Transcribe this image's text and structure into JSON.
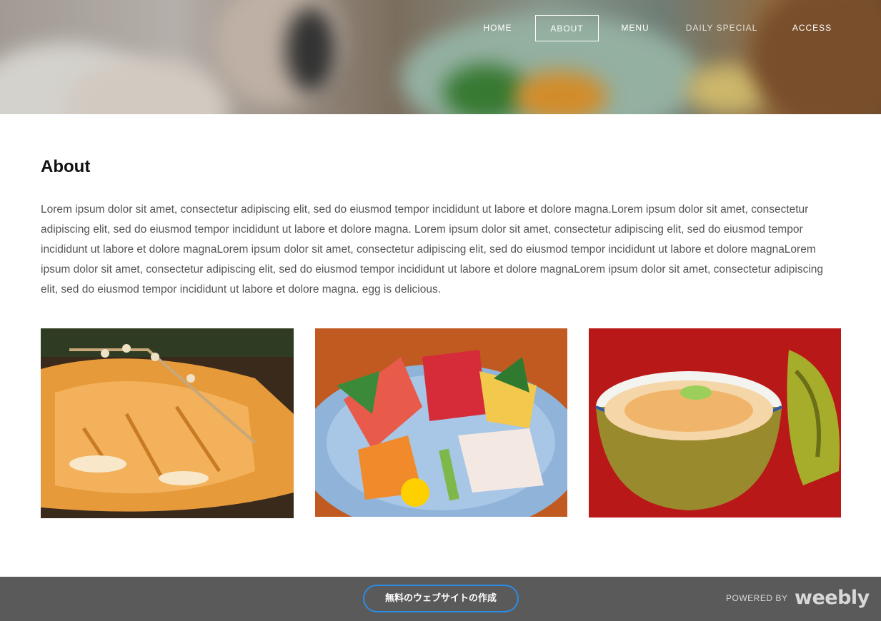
{
  "nav": {
    "items": [
      {
        "label": "HOME"
      },
      {
        "label": "ABOUT"
      },
      {
        "label": "MENU"
      },
      {
        "label": "DAILY SPECIAL"
      },
      {
        "label": "ACCESS"
      }
    ],
    "active": "ABOUT"
  },
  "main": {
    "title": "About",
    "paragraph": " Lorem ipsum dolor sit amet, consectetur adipiscing elit, sed do eiusmod tempor incididunt ut labore et dolore magna.Lorem ipsum dolor sit amet, consectetur adipiscing elit, sed do eiusmod tempor incididunt ut labore et dolore magna. Lorem ipsum dolor sit amet, consectetur adipiscing elit, sed do eiusmod tempor incididunt ut labore et dolore magnaLorem ipsum dolor sit amet, consectetur adipiscing elit, sed do eiusmod tempor incididunt ut labore et dolore magnaLorem ipsum dolor sit amet, consectetur adipiscing elit, sed do eiusmod tempor incididunt ut labore et dolore magnaLorem ipsum dolor sit amet, consectetur adipiscing elit, sed do eiusmod tempor incididunt ut labore et dolore magna. egg is delicious."
  },
  "footer": {
    "cta_label": "無料のウェブサイトの作成",
    "powered_by": "POWERED BY",
    "logo_text": "weebly"
  },
  "colors": {
    "cta_border": "#2c8be3",
    "footer_bg": "#5a5a5a"
  }
}
